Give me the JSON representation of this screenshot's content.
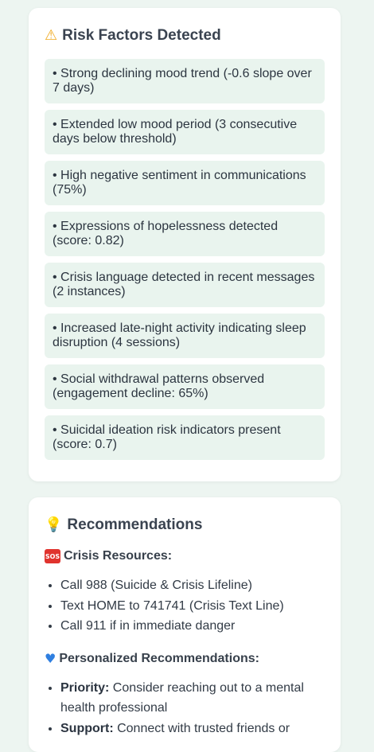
{
  "risk_section": {
    "icon": "warning-icon",
    "title": "Risk Factors Detected",
    "items": [
      "• Strong declining mood trend (-0.6 slope over 7 days)",
      "• Extended low mood period (3 consecutive days below threshold)",
      "• High negative sentiment in communications (75%)",
      "• Expressions of hopelessness detected (score: 0.82)",
      "• Crisis language detected in recent messages (2 instances)",
      "• Increased late-night activity indicating sleep disruption (4 sessions)",
      "• Social withdrawal patterns observed (engagement decline: 65%)",
      "• Suicidal ideation risk indicators present (score: 0.7)"
    ]
  },
  "recommendations_section": {
    "icon": "lightbulb-icon",
    "title": "Recommendations",
    "crisis": {
      "icon": "sos-icon",
      "icon_text": "SOS",
      "title": "Crisis Resources:",
      "items": [
        "Call 988 (Suicide & Crisis Lifeline)",
        "Text HOME to 741741 (Crisis Text Line)",
        "Call 911 if in immediate danger"
      ]
    },
    "personalized": {
      "icon": "blue-heart-icon",
      "title": "Personalized Recommendations:",
      "items": [
        {
          "label": "Priority:",
          "text": " Consider reaching out to a mental health professional"
        },
        {
          "label": "Support:",
          "text": " Connect with trusted friends or"
        }
      ]
    }
  },
  "colors": {
    "background": "#edf5f1",
    "card": "#ffffff",
    "risk_item_bg": "#e9f4ee",
    "sos_red": "#e0332e",
    "heart_blue": "#2f7fe0"
  }
}
